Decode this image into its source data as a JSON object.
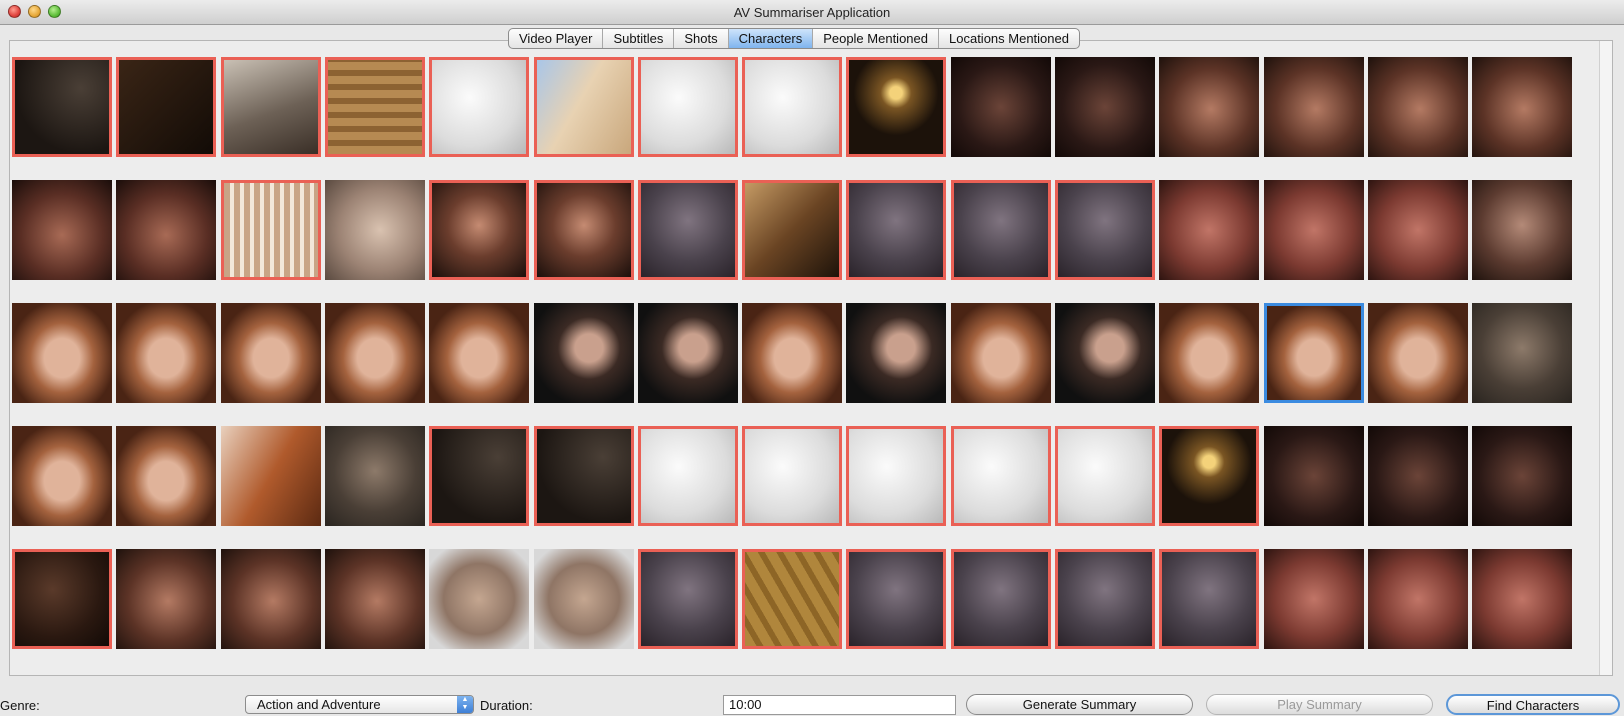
{
  "window": {
    "title": "AV Summariser Application"
  },
  "tabs": [
    {
      "label": "Video Player",
      "active": false
    },
    {
      "label": "Subtitles",
      "active": false
    },
    {
      "label": "Shots",
      "active": false
    },
    {
      "label": "Characters",
      "active": true
    },
    {
      "label": "People Mentioned",
      "active": false
    },
    {
      "label": "Locations Mentioned",
      "active": false
    }
  ],
  "thumbnails": {
    "columns": 15,
    "rows": [
      [
        "dark-corner",
        "dark-brown",
        "blurry-room",
        "wood-texture",
        "white-fabric",
        "fabric-blue",
        "white-fabric",
        "white-fabric",
        "chandelier",
        "dark-face",
        "dark-face",
        "woman-face",
        "woman-face",
        "woman-face",
        "woman-face"
      ],
      [
        "man-face",
        "man-face",
        "curtain-lace",
        "pale-face",
        "hand",
        "hand",
        "grey-fabric",
        "hair",
        "grey-fabric",
        "grey-fabric",
        "grey-fabric",
        "man-red-face",
        "man-red-face",
        "man-red-face",
        "man-looking-down"
      ],
      [
        "redhead-face",
        "redhead-face",
        "redhead-face",
        "redhead-face",
        "redhead-face",
        "dark-hair-man",
        "dark-hair-man",
        "redhead-face",
        "dark-hair-man",
        "redhead-face",
        "dark-hair-man",
        "redhead-face",
        "redhead-face",
        "redhead-face",
        "blurry-man"
      ],
      [
        "redhead-face",
        "redhead-face",
        "redhead-side",
        "blurry-man",
        "dark-corner",
        "dark-corner",
        "white-fabric",
        "white-fabric",
        "white-fabric",
        "white-fabric",
        "white-fabric",
        "chandelier",
        "dark-face",
        "dark-face",
        "dark-face"
      ],
      [
        "dark-hair",
        "woman-face",
        "woman-face",
        "woman-face",
        "window-woman",
        "window-woman",
        "grey-fabric",
        "wood-floor",
        "grey-fabric",
        "grey-fabric",
        "grey-fabric",
        "grey-fabric",
        "man-red-face",
        "man-red-face",
        "man-red-face"
      ]
    ],
    "highlighted": [
      [
        true,
        true,
        true,
        true,
        true,
        true,
        true,
        true,
        true,
        false,
        false,
        false,
        false,
        false,
        false
      ],
      [
        false,
        false,
        true,
        false,
        true,
        true,
        true,
        true,
        true,
        true,
        true,
        false,
        false,
        false,
        false
      ],
      [
        false,
        false,
        false,
        false,
        false,
        false,
        false,
        false,
        false,
        false,
        false,
        false,
        false,
        false,
        false
      ],
      [
        false,
        false,
        false,
        false,
        true,
        true,
        true,
        true,
        true,
        true,
        true,
        true,
        false,
        false,
        false
      ],
      [
        true,
        false,
        false,
        false,
        false,
        false,
        true,
        true,
        true,
        true,
        true,
        true,
        false,
        false,
        false
      ]
    ],
    "selected": {
      "row": 2,
      "col": 12
    }
  },
  "controls": {
    "genre_label": "Genre:",
    "genre_value": "Action and Adventure",
    "duration_label": "Duration:",
    "duration_value": "10:00",
    "generate_button": "Generate Summary",
    "play_button": "Play Summary",
    "find_button": "Find Characters"
  },
  "colors": {
    "highlight_border": "#ea6055",
    "selection_border": "#3b8be0",
    "active_tab": "#7fb4ee"
  }
}
